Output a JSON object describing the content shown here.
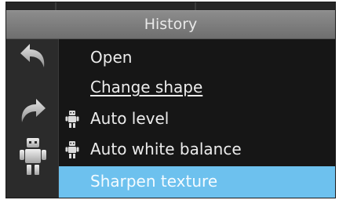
{
  "panel": {
    "title": "History"
  },
  "history": {
    "items": [
      {
        "label": "Open",
        "icon": "",
        "underline": false,
        "selected": false
      },
      {
        "label": "Change shape",
        "icon": "",
        "underline": true,
        "selected": false
      },
      {
        "label": "Auto level",
        "icon": "robot-icon",
        "underline": false,
        "selected": false
      },
      {
        "label": "Auto white balance",
        "icon": "robot-icon",
        "underline": false,
        "selected": false
      },
      {
        "label": "Sharpen texture",
        "icon": "",
        "underline": false,
        "selected": true
      }
    ]
  },
  "sidebar": {
    "tools": [
      {
        "name": "undo-icon"
      },
      {
        "name": "redo-icon"
      },
      {
        "name": "robot-icon"
      }
    ]
  },
  "colors": {
    "selection": "#6dc1ee",
    "header": "#7d7d7d",
    "list_bg": "#161616",
    "text": "#ececec"
  }
}
